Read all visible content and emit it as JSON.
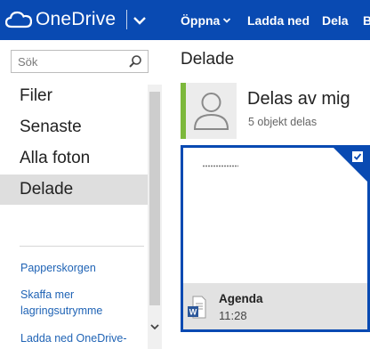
{
  "app": {
    "name": "OneDrive",
    "brand_color": "#094ab2"
  },
  "toolbar": {
    "open_label": "Öppna",
    "download_label": "Ladda ned",
    "share_label": "Dela",
    "more_label": "B"
  },
  "search": {
    "placeholder": "Sök",
    "icon": "search-icon"
  },
  "sidebar": {
    "items": [
      {
        "label": "Filer",
        "active": false
      },
      {
        "label": "Senaste",
        "active": false
      },
      {
        "label": "Alla foton",
        "active": false
      },
      {
        "label": "Delade",
        "active": true
      }
    ],
    "links": [
      {
        "label": "Papperskorgen"
      },
      {
        "label": "Skaffa mer lagringsutrymme"
      },
      {
        "label": "Ladda ned OneDrive-"
      }
    ]
  },
  "main": {
    "title": "Delade",
    "shared_with_me": {
      "title": "Delas av mig",
      "count_text": "5 objekt delas",
      "accent_color": "#7cb83b"
    },
    "file_tile": {
      "name": "Agenda",
      "time": "11:28",
      "type_icon": "word-icon",
      "selected": true
    }
  }
}
